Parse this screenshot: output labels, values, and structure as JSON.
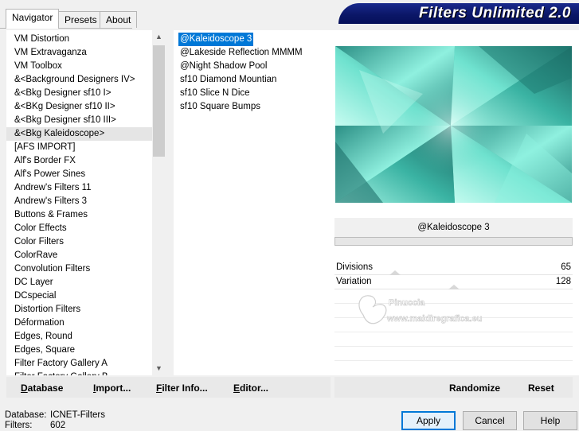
{
  "banner": {
    "title": "Filters Unlimited 2.0"
  },
  "tabs": [
    {
      "label": "Navigator",
      "active": true
    },
    {
      "label": "Presets",
      "active": false
    },
    {
      "label": "About",
      "active": false
    }
  ],
  "categories": [
    "VM Distortion",
    "VM Extravaganza",
    "VM Toolbox",
    "&<Background Designers IV>",
    "&<Bkg Designer sf10 I>",
    "&<BKg Designer sf10 II>",
    "&<Bkg Designer sf10 III>",
    "&<Bkg Kaleidoscope>",
    "[AFS IMPORT]",
    "Alf's Border FX",
    "Alf's Power Sines",
    "Andrew's Filters 11",
    "Andrew's Filters 3",
    "Buttons & Frames",
    "Color Effects",
    "Color Filters",
    "ColorRave",
    "Convolution Filters",
    "DC Layer",
    "DCspecial",
    "Distortion Filters",
    "Déformation",
    "Edges, Round",
    "Edges, Square",
    "Filter Factory Gallery A",
    "Filter Factory Gallery B"
  ],
  "selected_category_index": 7,
  "filters": [
    "@Kaleidoscope 3",
    "@Lakeside Reflection MMMM",
    "@Night Shadow Pool",
    "sf10 Diamond Mountian",
    "sf10 Slice N Dice",
    "sf10 Square Bumps"
  ],
  "selected_filter_index": 0,
  "preview": {
    "filter_name": "@Kaleidoscope 3"
  },
  "params": [
    {
      "label": "Divisions",
      "value": "65",
      "fraction": 0.255
    },
    {
      "label": "Variation",
      "value": "128",
      "fraction": 0.502
    }
  ],
  "watermark": {
    "line1": "Pinuccia",
    "line2": "www.maidiregrafica.eu"
  },
  "left_buttons": {
    "database": "Database",
    "import": "Import...",
    "filter_info": "Filter Info...",
    "editor": "Editor..."
  },
  "right_buttons": {
    "randomize": "Randomize",
    "reset": "Reset"
  },
  "status": {
    "database_label": "Database:",
    "database_value": "ICNET-Filters",
    "filters_label": "Filters:",
    "filters_value": "602"
  },
  "dialog_buttons": {
    "apply": "Apply",
    "cancel": "Cancel",
    "help": "Help"
  },
  "colors": {
    "selection": "#0078d7",
    "banner": "#0b1768",
    "preview_teal": "#5fd3c0",
    "preview_dark": "#1e6f6a"
  },
  "icons": {
    "scroll_up": "▲",
    "scroll_down": "▼"
  }
}
